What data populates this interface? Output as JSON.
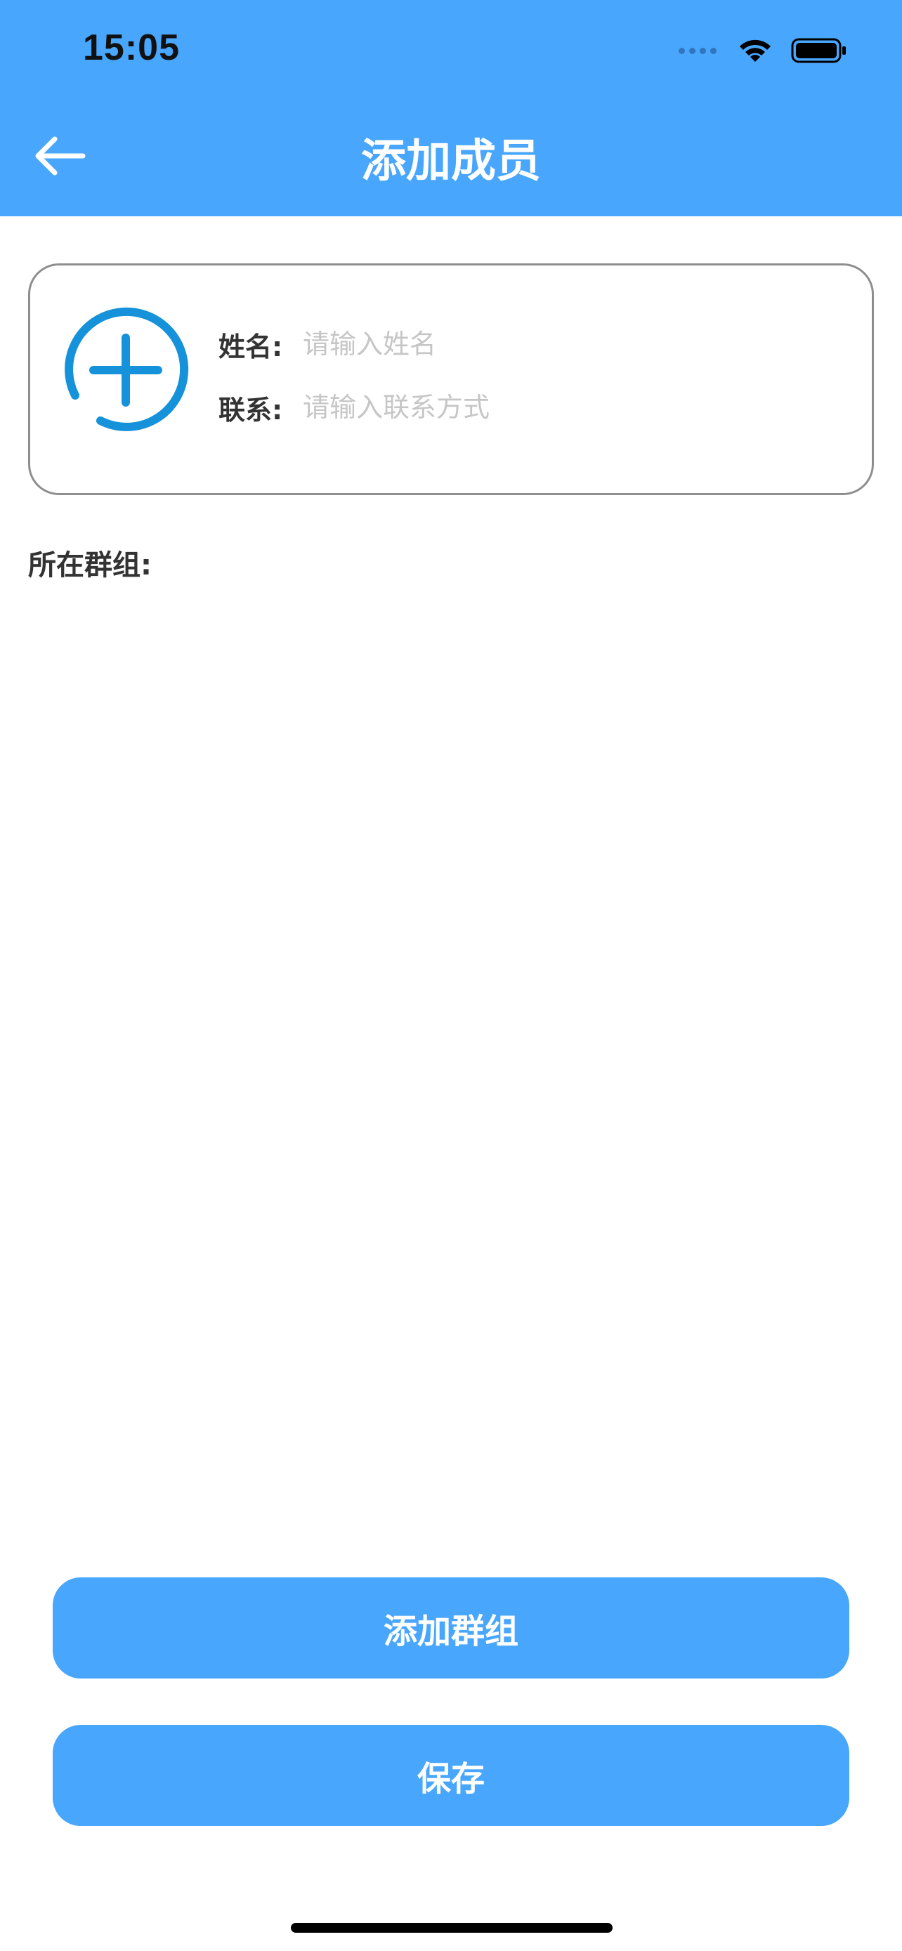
{
  "status_bar": {
    "time": "15:05",
    "icons": [
      "cellular-signal-icon",
      "wifi-icon",
      "battery-icon"
    ]
  },
  "nav": {
    "back_icon": "arrow-left-icon",
    "title": "添加成员"
  },
  "member_form": {
    "avatar_icon": "add-circle-icon",
    "name_label": "姓名:",
    "name_placeholder": "请输入姓名",
    "name_value": "",
    "contact_label": "联系:",
    "contact_placeholder": "请输入联系方式",
    "contact_value": ""
  },
  "group": {
    "label": "所在群组:"
  },
  "actions": {
    "add_group_label": "添加群组",
    "save_label": "保存"
  },
  "colors": {
    "primary": "#49a6fd",
    "icon_accent": "#1592d9",
    "text": "#333333",
    "placeholder": "#c6c6c6",
    "card_border": "#8e8e8e"
  }
}
